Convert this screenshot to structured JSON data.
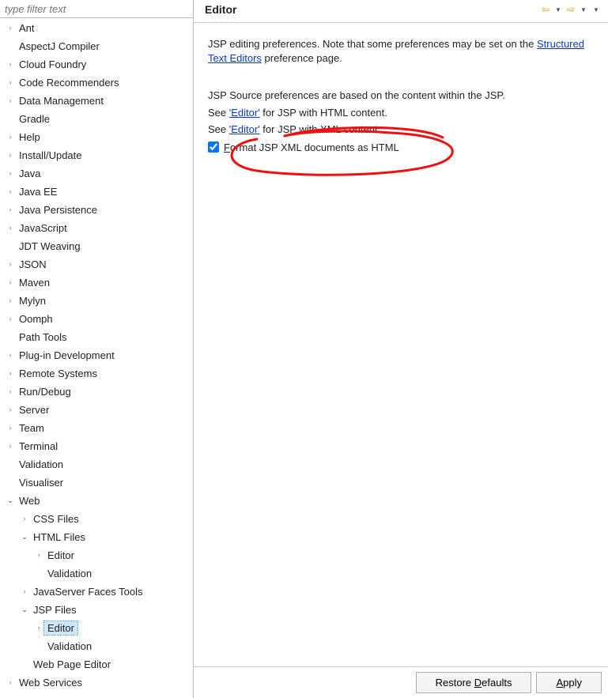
{
  "sidebar": {
    "filter_placeholder": "type filter text",
    "items": [
      {
        "label": "Ant",
        "caret": "closed",
        "ind": 0
      },
      {
        "label": "AspectJ Compiler",
        "caret": "none",
        "ind": 0
      },
      {
        "label": "Cloud Foundry",
        "caret": "closed",
        "ind": 0
      },
      {
        "label": "Code Recommenders",
        "caret": "closed",
        "ind": 0
      },
      {
        "label": "Data Management",
        "caret": "closed",
        "ind": 0
      },
      {
        "label": "Gradle",
        "caret": "none",
        "ind": 0
      },
      {
        "label": "Help",
        "caret": "closed",
        "ind": 0
      },
      {
        "label": "Install/Update",
        "caret": "closed",
        "ind": 0
      },
      {
        "label": "Java",
        "caret": "closed",
        "ind": 0
      },
      {
        "label": "Java EE",
        "caret": "closed",
        "ind": 0
      },
      {
        "label": "Java Persistence",
        "caret": "closed",
        "ind": 0
      },
      {
        "label": "JavaScript",
        "caret": "closed",
        "ind": 0
      },
      {
        "label": "JDT Weaving",
        "caret": "none",
        "ind": 0
      },
      {
        "label": "JSON",
        "caret": "closed",
        "ind": 0
      },
      {
        "label": "Maven",
        "caret": "closed",
        "ind": 0
      },
      {
        "label": "Mylyn",
        "caret": "closed",
        "ind": 0
      },
      {
        "label": "Oomph",
        "caret": "closed",
        "ind": 0
      },
      {
        "label": "Path Tools",
        "caret": "none",
        "ind": 0
      },
      {
        "label": "Plug-in Development",
        "caret": "closed",
        "ind": 0
      },
      {
        "label": "Remote Systems",
        "caret": "closed",
        "ind": 0
      },
      {
        "label": "Run/Debug",
        "caret": "closed",
        "ind": 0
      },
      {
        "label": "Server",
        "caret": "closed",
        "ind": 0
      },
      {
        "label": "Team",
        "caret": "closed",
        "ind": 0
      },
      {
        "label": "Terminal",
        "caret": "closed",
        "ind": 0
      },
      {
        "label": "Validation",
        "caret": "none",
        "ind": 0
      },
      {
        "label": "Visualiser",
        "caret": "none",
        "ind": 0
      },
      {
        "label": "Web",
        "caret": "open",
        "ind": 0
      },
      {
        "label": "CSS Files",
        "caret": "closed",
        "ind": 1
      },
      {
        "label": "HTML Files",
        "caret": "open",
        "ind": 1
      },
      {
        "label": "Editor",
        "caret": "closed",
        "ind": 2
      },
      {
        "label": "Validation",
        "caret": "none",
        "ind": 2
      },
      {
        "label": "JavaServer Faces Tools",
        "caret": "closed",
        "ind": 1
      },
      {
        "label": "JSP Files",
        "caret": "open",
        "ind": 1
      },
      {
        "label": "Editor",
        "caret": "closed",
        "ind": 2,
        "selected": true
      },
      {
        "label": "Validation",
        "caret": "none",
        "ind": 2
      },
      {
        "label": "Web Page Editor",
        "caret": "none",
        "ind": 1
      },
      {
        "label": "Web Services",
        "caret": "closed",
        "ind": 0
      }
    ]
  },
  "header": {
    "title": "Editor"
  },
  "content": {
    "p1_a": "JSP editing preferences.  Note that some preferences may be set on the ",
    "p1_link": "Structured Text Editors",
    "p1_b": " preference page.",
    "p2": "JSP Source preferences are based on the content within the JSP.",
    "p3_a": "See ",
    "p3_link": "'Editor'",
    "p3_b": " for JSP with HTML content.",
    "p4_a": "See ",
    "p4_link": "'Editor'",
    "p4_b": " for JSP with XML content.",
    "checkbox_label": "Format JSP XML documents as HTML",
    "checkbox_checked": true
  },
  "footer": {
    "restore": "Restore Defaults",
    "apply": "Apply"
  }
}
